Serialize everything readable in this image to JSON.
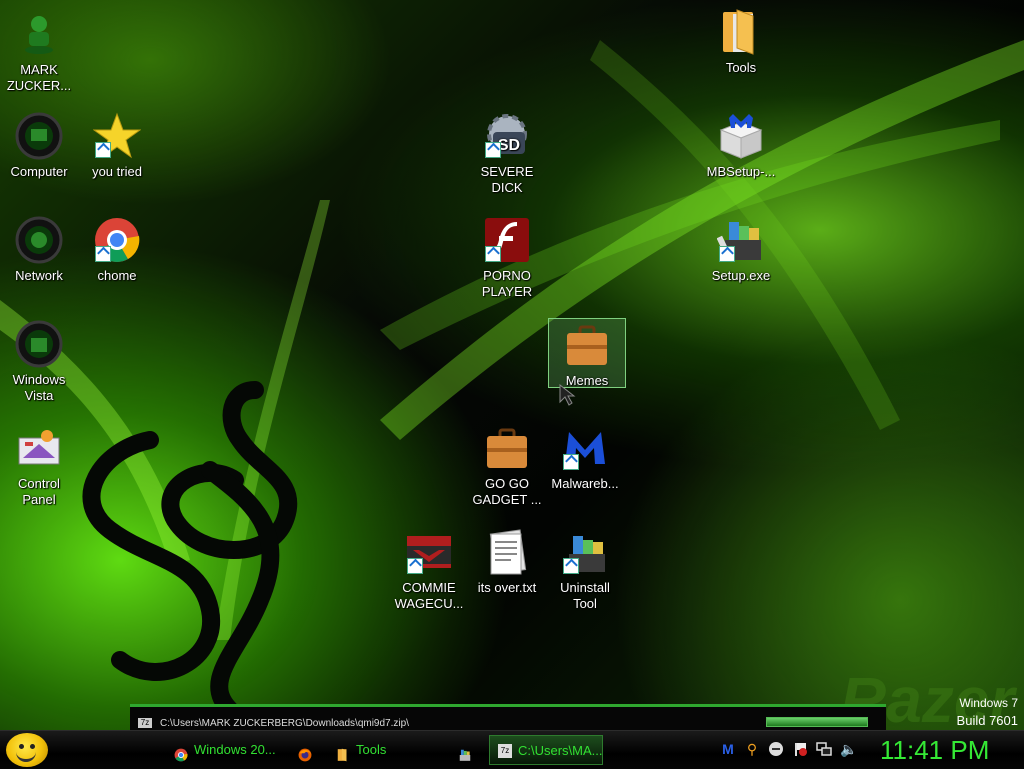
{
  "desktop": {
    "icons": {
      "mark_zucker": {
        "label": "MARK\nZUCKER..."
      },
      "computer": {
        "label": "Computer"
      },
      "you_tried": {
        "label": "you tried"
      },
      "network": {
        "label": "Network"
      },
      "chome": {
        "label": "chome"
      },
      "windows_vista": {
        "label": "Windows\nVista"
      },
      "control_panel": {
        "label": "Control\nPanel"
      },
      "severe_dick": {
        "label": "SEVERE\nDICK"
      },
      "porno_player": {
        "label": "PORNO\nPLAYER"
      },
      "memes": {
        "label": "Memes"
      },
      "go_go_gadget": {
        "label": "GO GO\nGADGET ..."
      },
      "malwareb": {
        "label": "Malwareb..."
      },
      "commie_wagecu": {
        "label": "COMMIE\nWAGECU..."
      },
      "its_over": {
        "label": "its over.txt"
      },
      "uninstall_tool": {
        "label": "Uninstall\nTool"
      },
      "tools": {
        "label": "Tools"
      },
      "mbsetup": {
        "label": "MBSetup-..."
      },
      "setup_exe": {
        "label": "Setup.exe"
      }
    },
    "sd_badge": "SD",
    "watermark": {
      "line1": "Windows 7",
      "line2": "Build 7601"
    }
  },
  "progress": {
    "path": "C:\\Users\\MARK ZUCKERBERG\\Downloads\\qmi9d7.zip\\",
    "icon_text": "7z"
  },
  "taskbar": {
    "buttons": [
      {
        "label": "Windows 20...",
        "icon": "chrome-icon"
      },
      {
        "label": "",
        "icon": "firefox-icon"
      },
      {
        "label": "Tools",
        "icon": "folder-icon"
      },
      {
        "label": "",
        "icon": "installer-icon"
      },
      {
        "label": "C:\\Users\\MA...",
        "icon": "7zip-icon",
        "active": true
      }
    ],
    "tray_icons": [
      "malwarebytes-icon",
      "search-icon",
      "skype-icon",
      "action-center-flag-icon",
      "network-icon",
      "volume-icon"
    ],
    "clock": "11:41 PM"
  },
  "colors": {
    "accent": "#35e935",
    "background": "#050805"
  }
}
